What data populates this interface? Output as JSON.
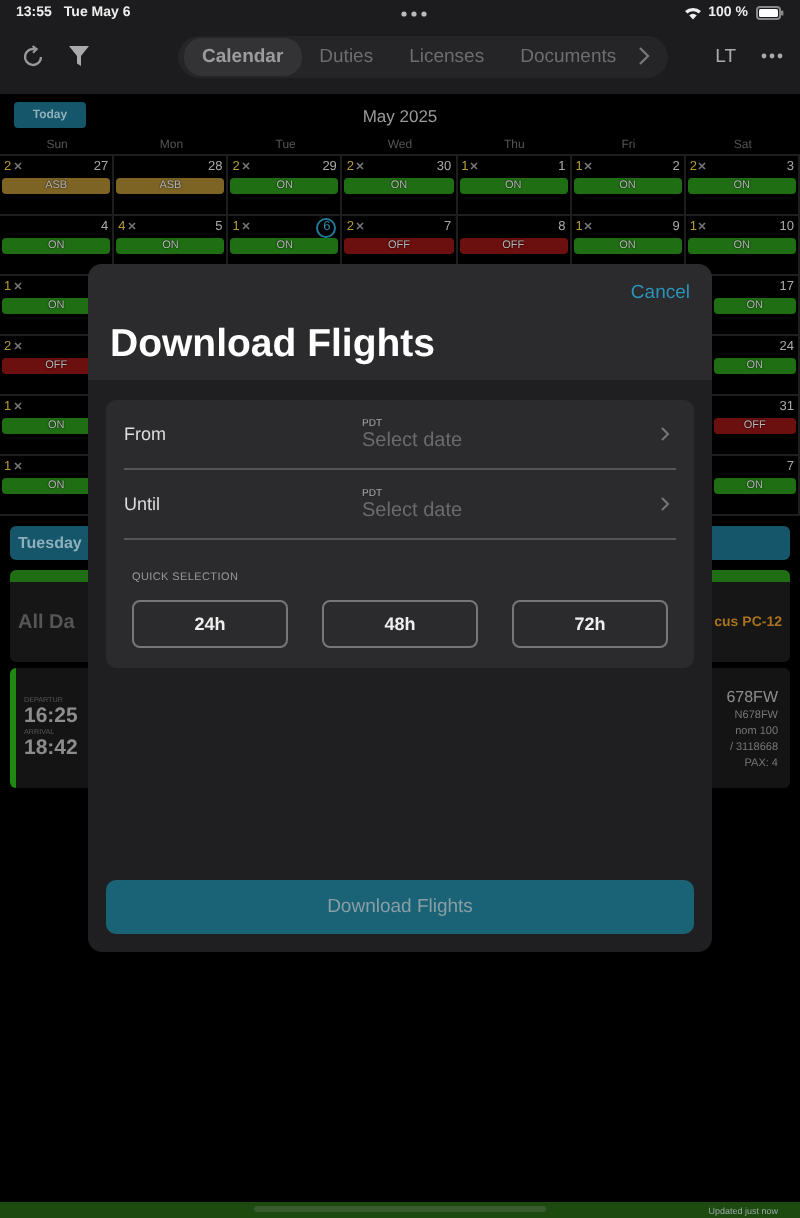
{
  "status_bar": {
    "time": "13:55",
    "date": "Tue May 6",
    "battery": "100 %"
  },
  "toolbar": {
    "tabs": [
      {
        "label": "Calendar",
        "selected": true
      },
      {
        "label": "Duties",
        "selected": false
      },
      {
        "label": "Licenses",
        "selected": false
      },
      {
        "label": "Documents",
        "selected": false
      }
    ],
    "account": "LT"
  },
  "calendar": {
    "today_button": "Today",
    "month": "May 2025",
    "weekdays": [
      "Sun",
      "Mon",
      "Tue",
      "Wed",
      "Thu",
      "Fri",
      "Sat"
    ],
    "weeks": [
      {
        "days": [
          {
            "count": "2",
            "date": "27",
            "status": "ASB",
            "color": "#7d6424",
            "today": false
          },
          {
            "date": "28",
            "status": "ASB",
            "color": "#7d6424",
            "today": false
          },
          {
            "count": "2",
            "date": "29",
            "status": "ON",
            "color": "#1f6e14",
            "today": false
          },
          {
            "count": "2",
            "date": "30",
            "status": "ON",
            "color": "#1f6e14",
            "today": false
          },
          {
            "count": "1",
            "date": "1",
            "status": "ON",
            "color": "#1f6e14",
            "today": false
          },
          {
            "count": "1",
            "date": "2",
            "status": "ON",
            "color": "#1f6e14",
            "today": false
          },
          {
            "count": "2",
            "date": "3",
            "status": "ON",
            "color": "#1f6e14",
            "today": false
          }
        ]
      },
      {
        "days": [
          {
            "date": "4",
            "status": "ON",
            "color": "#1f6e14",
            "today": false
          },
          {
            "count": "4",
            "date": "5",
            "status": "ON",
            "color": "#1f6e14",
            "today": false
          },
          {
            "count": "1",
            "date": "6",
            "status": "ON",
            "color": "#1f6e14",
            "today": true
          },
          {
            "count": "2",
            "date": "7",
            "status": "OFF",
            "color": "#6b0f0f",
            "today": false
          },
          {
            "date": "8",
            "status": "OFF",
            "color": "#6b0f0f",
            "today": false
          },
          {
            "count": "1",
            "date": "9",
            "status": "ON",
            "color": "#1f6e14",
            "today": false
          },
          {
            "count": "1",
            "date": "10",
            "status": "ON",
            "color": "#1f6e14",
            "today": false
          }
        ]
      }
    ],
    "partial_weeks": [
      {
        "sunday": {
          "count": "1",
          "status": "ON",
          "color": "#1f6e14"
        },
        "saturday": {
          "date": "17",
          "status": "ON",
          "color": "#1f6e14"
        }
      },
      {
        "sunday": {
          "count": "2",
          "status": "OFF",
          "color": "#6b0f0f"
        },
        "saturday": {
          "date": "24",
          "status": "ON",
          "color": "#1f6e14"
        }
      },
      {
        "sunday": {
          "count": "1",
          "status": "ON",
          "color": "#1f6e14"
        },
        "saturday": {
          "date": "31",
          "status": "OFF",
          "color": "#6b0f0f"
        }
      },
      {
        "sunday": {
          "count": "1",
          "status": "ON",
          "color": "#1f6e14"
        },
        "saturday": {
          "date": "7",
          "status": "ON",
          "color": "#1f6e14"
        }
      }
    ]
  },
  "agenda": {
    "day": "Tuesday",
    "all_day": {
      "label": "All Da",
      "aircraft": "cus PC-12"
    },
    "flight": {
      "departure_label": "DEPARTUR",
      "departure_time": "16:25",
      "arrival_label": "ARRIVAL",
      "arrival_time": "18:42",
      "lines": [
        "678FW",
        "N678FW",
        "nom 100",
        "/ 3118668",
        "PAX: 4"
      ]
    }
  },
  "modal": {
    "cancel": "Cancel",
    "title": "Download Flights",
    "fields": [
      {
        "label": "From",
        "timezone": "PDT",
        "placeholder": "Select date"
      },
      {
        "label": "Until",
        "timezone": "PDT",
        "placeholder": "Select date"
      }
    ],
    "quick_selection": {
      "label": "QUICK SELECTION",
      "options": [
        "24h",
        "48h",
        "72h"
      ]
    },
    "download_button": {
      "label": "Download Flights",
      "disabled": true
    }
  },
  "footer": {
    "updated": "Updated just now"
  }
}
